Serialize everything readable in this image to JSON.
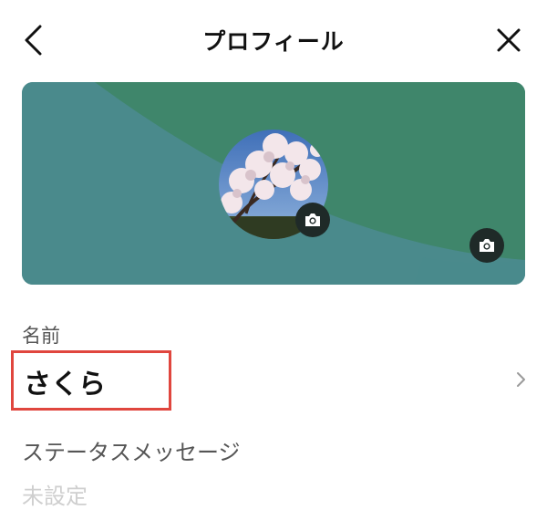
{
  "header": {
    "title": "プロフィール",
    "back_icon": "chevron-left-icon",
    "close_icon": "close-icon"
  },
  "profile": {
    "cover_colors": {
      "base": "#4a8a8c",
      "accent": "#3f866b"
    },
    "avatar_alt": "cherry-blossom-photo",
    "camera_icon": "camera-icon"
  },
  "name_field": {
    "label": "名前",
    "value": "さくら",
    "highlight_color": "#e0463e"
  },
  "status_field": {
    "label": "ステータスメッセージ",
    "value": "未設定"
  }
}
